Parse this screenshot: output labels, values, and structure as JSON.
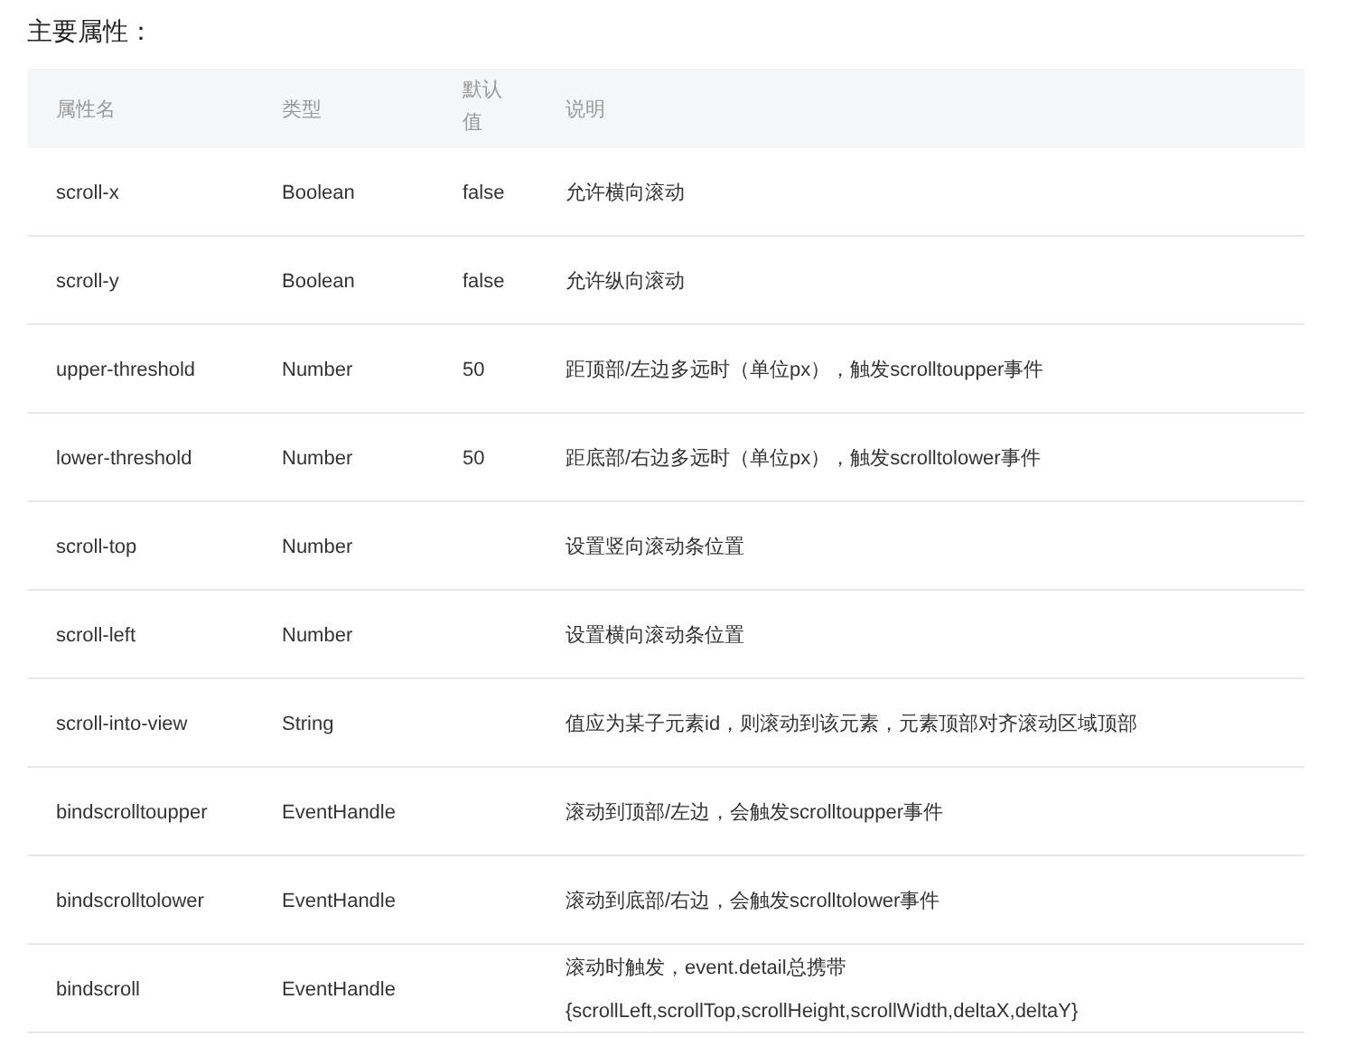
{
  "title": "主要属性：",
  "table": {
    "columns": [
      "属性名",
      "类型",
      "默认值",
      "说明"
    ],
    "rows": [
      [
        "scroll-x",
        "Boolean",
        "false",
        "允许横向滚动"
      ],
      [
        "scroll-y",
        "Boolean",
        "false",
        "允许纵向滚动"
      ],
      [
        "upper-threshold",
        "Number",
        "50",
        "距顶部/左边多远时（单位px），触发scrolltoupper事件"
      ],
      [
        "lower-threshold",
        "Number",
        "50",
        "距底部/右边多远时（单位px），触发scrolltolower事件"
      ],
      [
        "scroll-top",
        "Number",
        "",
        "设置竖向滚动条位置"
      ],
      [
        "scroll-left",
        "Number",
        "",
        "设置横向滚动条位置"
      ],
      [
        "scroll-into-view",
        "String",
        "",
        "值应为某子元素id，则滚动到该元素，元素顶部对齐滚动区域顶部"
      ],
      [
        "bindscrolltoupper",
        "EventHandle",
        "",
        "滚动到顶部/左边，会触发scrolltoupper事件"
      ],
      [
        "bindscrolltolower",
        "EventHandle",
        "",
        "滚动到底部/右边，会触发scrolltolower事件"
      ],
      [
        "bindscroll",
        "EventHandle",
        "",
        "滚动时触发，event.detail总携带\n{scrollLeft,scrollTop,scrollHeight,scrollWidth,deltaX,deltaY}"
      ]
    ]
  }
}
